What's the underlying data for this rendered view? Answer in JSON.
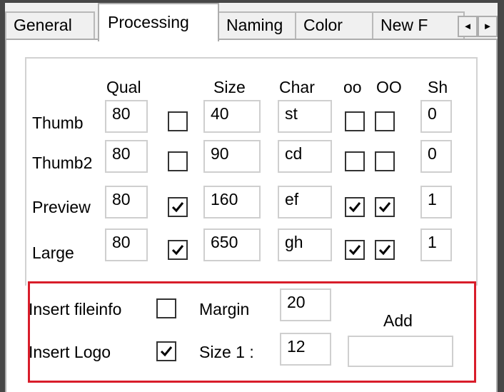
{
  "tabs": [
    "General",
    "Processing",
    "Naming",
    "Color",
    "New F"
  ],
  "active_tab": "Processing",
  "scroll_buttons": {
    "left": "◄",
    "right": "►"
  },
  "columns": {
    "qual": "Qual",
    "size": "Size",
    "char": "Char",
    "oo": "oo",
    "OO": "OO",
    "sh": "Sh"
  },
  "rows": [
    {
      "label": "Thumb",
      "qual": "80",
      "qual_checked": false,
      "size": "40",
      "char": "st",
      "oo": false,
      "OO": false,
      "sh": "0"
    },
    {
      "label": "Thumb2",
      "qual": "80",
      "qual_checked": false,
      "size": "90",
      "char": "cd",
      "oo": false,
      "OO": false,
      "sh": "0"
    },
    {
      "label": "Preview",
      "qual": "80",
      "qual_checked": true,
      "size": "160",
      "char": "ef",
      "oo": true,
      "OO": true,
      "sh": "1"
    },
    {
      "label": "Large",
      "qual": "80",
      "qual_checked": true,
      "size": "650",
      "char": "gh",
      "oo": true,
      "OO": true,
      "sh": "1"
    }
  ],
  "options": {
    "insert_fileinfo_label": "Insert fileinfo",
    "insert_fileinfo_checked": false,
    "insert_logo_label": "Insert Logo",
    "insert_logo_checked": true,
    "margin_label": "Margin",
    "margin_value": "20",
    "size_label": "Size 1 :",
    "size_value": "12",
    "add_label": "Add",
    "add_value": ""
  },
  "highlight_color": "#d81d2a"
}
